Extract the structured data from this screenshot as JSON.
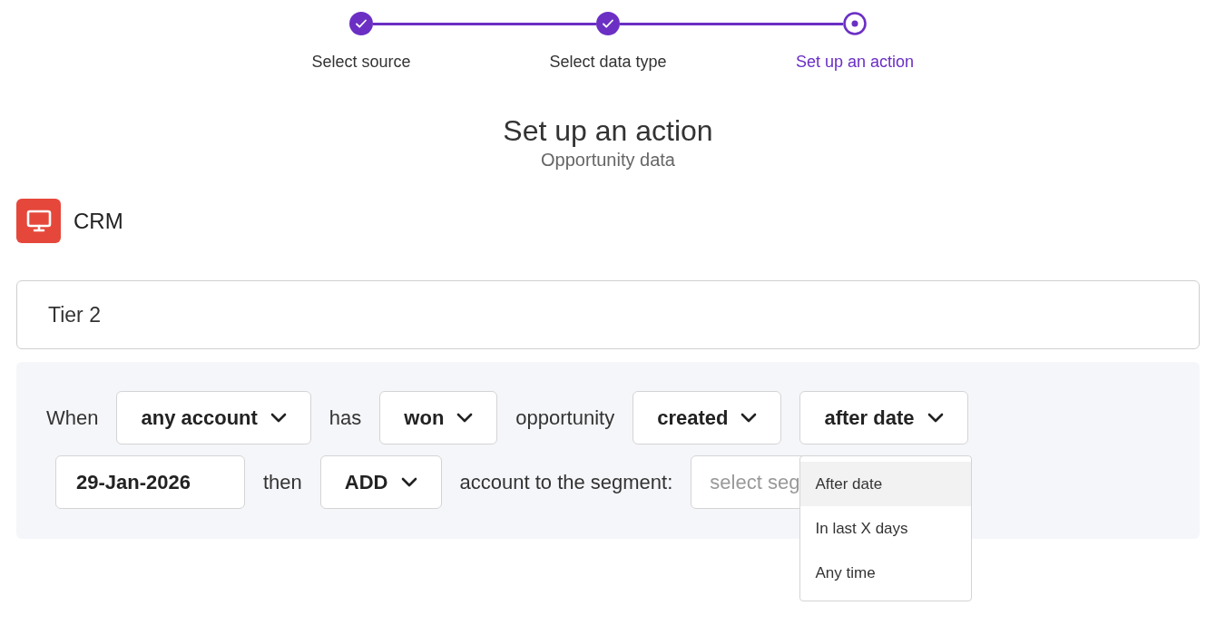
{
  "steps": [
    {
      "label": "Select source",
      "completed": true,
      "selected": false
    },
    {
      "label": "Select data type",
      "completed": true,
      "selected": false
    },
    {
      "label": "Set up an action",
      "completed": false,
      "selected": true
    }
  ],
  "title": "Set up an action",
  "subtitle": "Opportunity data",
  "source": {
    "name": "CRM"
  },
  "segment_name": {
    "value": "Tier 2"
  },
  "rule_rows": [
    [
      {
        "kind": "text",
        "text": "When"
      },
      {
        "kind": "dropdown",
        "value": "any account"
      },
      {
        "kind": "text",
        "text": "has"
      },
      {
        "kind": "dropdown",
        "value": "won"
      },
      {
        "kind": "text",
        "text": "opportunity"
      },
      {
        "kind": "dropdown",
        "value": "created"
      },
      {
        "kind": "dropdown",
        "value": "after date",
        "options": [
          {
            "label": "After date",
            "selected": true
          },
          {
            "label": "In last X days",
            "selected": false
          },
          {
            "label": "Any time",
            "selected": false
          }
        ]
      }
    ],
    [
      {
        "kind": "input",
        "value": "29-Jan-2026"
      },
      {
        "kind": "text",
        "text": "then"
      },
      {
        "kind": "dropdown",
        "value": "ADD"
      },
      {
        "kind": "text",
        "text": "account to the segment:"
      },
      {
        "kind": "field",
        "placeholder": "select seg"
      }
    ]
  ]
}
